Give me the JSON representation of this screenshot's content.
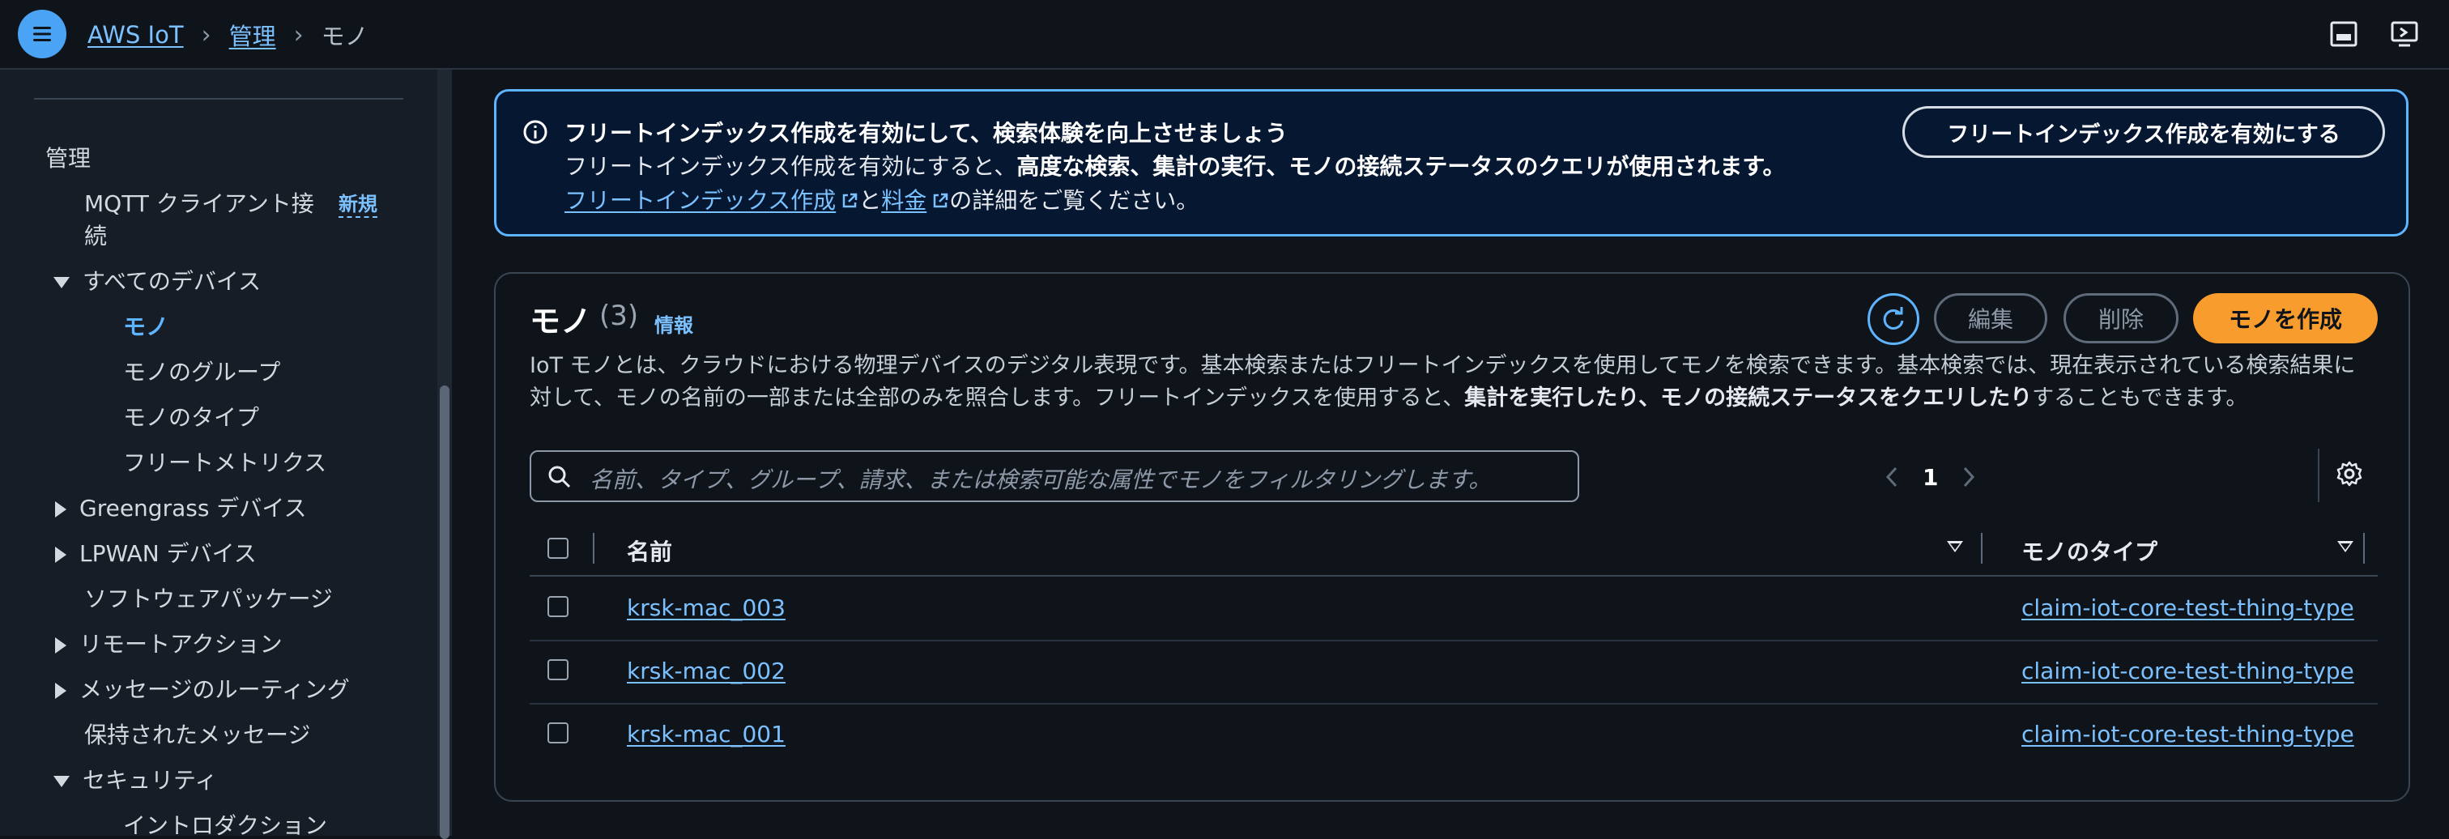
{
  "topbar": {
    "breadcrumb": [
      {
        "label": "AWS IoT"
      },
      {
        "label": "管理"
      },
      {
        "label": "モノ"
      }
    ]
  },
  "sidebar": {
    "section_title": "管理",
    "mqtt_client_line1": "MQTT クライアント接",
    "mqtt_client_line2": "続",
    "new_badge": "新規",
    "all_devices": "すべてのデバイス",
    "things": "モノ",
    "thing_groups": "モノのグループ",
    "thing_types": "モノのタイプ",
    "fleet_metrics": "フリートメトリクス",
    "greengrass": "Greengrass デバイス",
    "lpwan": "LPWAN デバイス",
    "software_packages": "ソフトウェアパッケージ",
    "remote_actions": "リモートアクション",
    "message_routing": "メッセージのルーティング",
    "retained_messages": "保持されたメッセージ",
    "security": "セキュリティ",
    "introduction": "イントロダクション"
  },
  "flash": {
    "title": "フリートインデックス作成を有効にして、検索体験を向上させましょう",
    "body_prefix": "フリートインデックス作成を有効にすると、",
    "body_bold": "高度な検索、集計の実行、モノの接続ステータスのクエリが使用されます。",
    "link1_line1": "フリー",
    "link1_line2": "トインデックス作成",
    "middle": "と",
    "link2": "料金",
    "suffix": "の詳細をご覧ください。",
    "button": "フリートインデックス作成を有効にする"
  },
  "things_panel": {
    "title": "モノ",
    "count": "(3)",
    "info_link": "情報",
    "desc_part1": "IoT モノとは、クラウドにおける物理デバイスのデジタル表現です。基本検索またはフリートインデックスを使用してモノを検索できます。基本検索では、現在表示されている検索結果に対して、モノの名前の一部または全部のみを照合します。フリートインデックスを使用すると、",
    "desc_bold": "集計を実行したり、モノの接続ステータスをクエリしたり",
    "desc_part2": "することもできます。",
    "edit_button": "編集",
    "delete_button": "削除",
    "create_button": "モノを作成",
    "search_placeholder": "名前、タイプ、グループ、請求、または検索可能な属性でモノをフィルタリングします。",
    "page_number": "1",
    "columns": [
      "名前",
      "モノのタイプ"
    ],
    "rows": [
      {
        "name": "krsk-mac_003",
        "type": "claim-iot-core-test-thing-type"
      },
      {
        "name": "krsk-mac_002",
        "type": "claim-iot-core-test-thing-type"
      },
      {
        "name": "krsk-mac_001",
        "type": "claim-iot-core-test-thing-type"
      }
    ]
  },
  "colors": {
    "accent": "#5fb4ff",
    "primary_button": "#f89c2d",
    "background": "#0f141a",
    "sidebar": "#161d26"
  }
}
